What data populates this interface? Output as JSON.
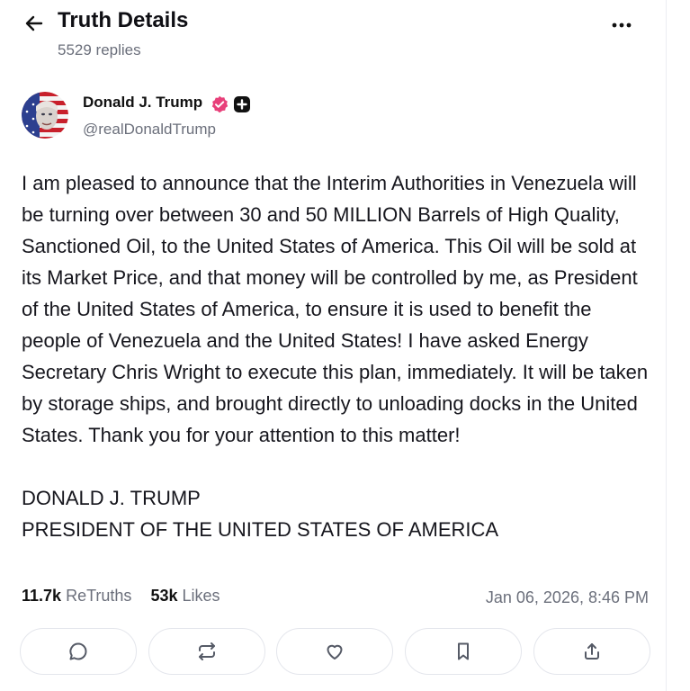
{
  "header": {
    "title": "Truth Details",
    "replies": "5529 replies",
    "back_icon": "arrow-left-icon",
    "more_icon": "more-horizontal-icon"
  },
  "author": {
    "name": "Donald J. Trump",
    "handle": "@realDonaldTrump",
    "verified_color": "#e8407a"
  },
  "post": {
    "paragraphs": [
      "I am pleased to announce that the Interim Authorities in Venezuela will be turning over between 30 and 50 MILLION Barrels of High Quality, Sanctioned Oil, to the United States of America. This Oil will be sold at its Market Price, and that money will be controlled by me, as President of the United States of America, to ensure it is used to benefit the people of Venezuela and the United States! I have asked Energy Secretary Chris Wright to execute this plan, immediately. It will be taken by storage ships, and brought directly to unloading docks in the United States. Thank you for your attention to this matter!"
    ],
    "signature_line1": "DONALD J. TRUMP",
    "signature_line2": "PRESIDENT OF THE UNITED STATES OF AMERICA"
  },
  "stats": {
    "retruths_count": "11.7k",
    "retruths_label": "ReTruths",
    "likes_count": "53k",
    "likes_label": "Likes",
    "timestamp": "Jan 06, 2026, 8:46 PM"
  },
  "actions": [
    "reply-icon",
    "retruth-icon",
    "like-icon",
    "bookmark-icon",
    "share-icon"
  ]
}
